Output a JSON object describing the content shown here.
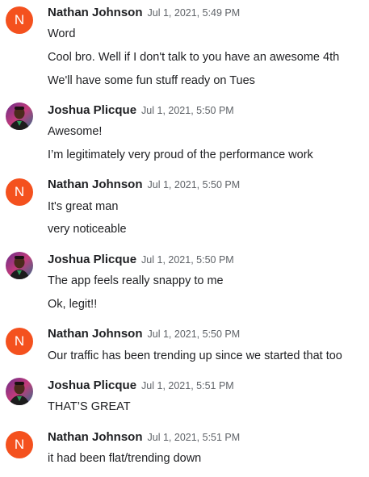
{
  "messages": [
    {
      "author": "Nathan Johnson",
      "avatar": "N",
      "avatar_color": "#f4511e",
      "timestamp": "Jul 1, 2021, 5:49 PM",
      "lines": [
        "Word",
        "Cool bro. Well if I don't talk to you have an awesome 4th",
        "We'll have some fun stuff ready on Tues"
      ]
    },
    {
      "author": "Joshua Plicque",
      "avatar": "photo",
      "timestamp": "Jul 1, 2021, 5:50 PM",
      "lines": [
        "Awesome!",
        "I’m legitimately very proud of the performance work"
      ]
    },
    {
      "author": "Nathan Johnson",
      "avatar": "N",
      "avatar_color": "#f4511e",
      "timestamp": "Jul 1, 2021, 5:50 PM",
      "lines": [
        "It's great man",
        "very noticeable"
      ]
    },
    {
      "author": "Joshua Plicque",
      "avatar": "photo",
      "timestamp": "Jul 1, 2021, 5:50 PM",
      "lines": [
        "The app feels really snappy to me",
        "Ok, legit!!"
      ]
    },
    {
      "author": "Nathan Johnson",
      "avatar": "N",
      "avatar_color": "#f4511e",
      "timestamp": "Jul 1, 2021, 5:50 PM",
      "lines": [
        "Our traffic has been trending up since we started that too"
      ]
    },
    {
      "author": "Joshua Plicque",
      "avatar": "photo",
      "timestamp": "Jul 1, 2021, 5:51 PM",
      "lines": [
        "THAT’S GREAT"
      ]
    },
    {
      "author": "Nathan Johnson",
      "avatar": "N",
      "avatar_color": "#f4511e",
      "timestamp": "Jul 1, 2021, 5:51 PM",
      "lines": [
        "it had been flat/trending down"
      ]
    }
  ]
}
